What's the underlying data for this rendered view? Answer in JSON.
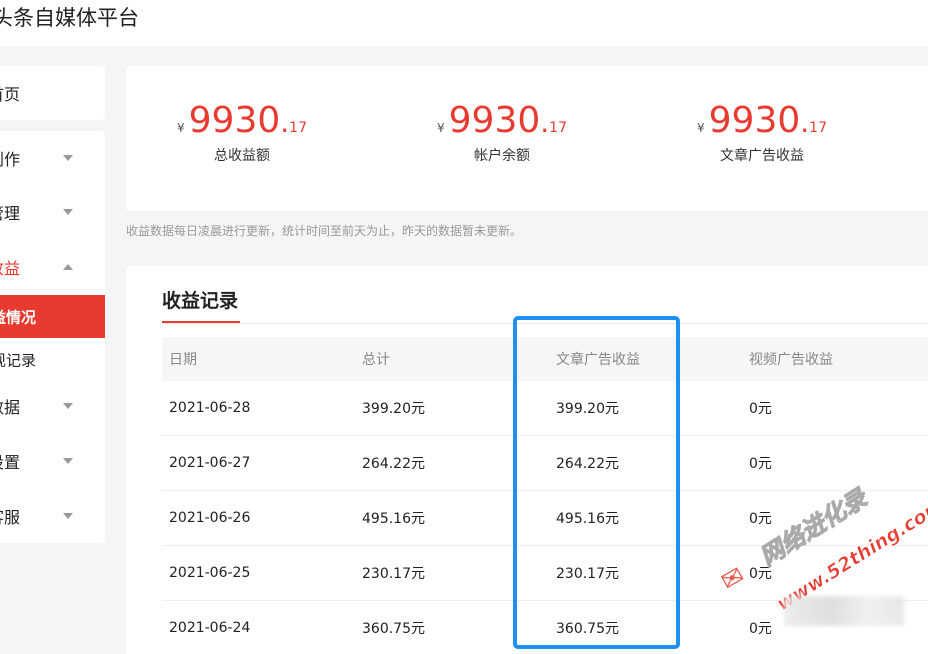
{
  "header": {
    "title": "头条自媒体平台"
  },
  "sidebar": {
    "home": "首页",
    "items": [
      {
        "label": "创作",
        "caret": "down"
      },
      {
        "label": "管理",
        "caret": "down"
      },
      {
        "label": "收益",
        "caret": "up",
        "open": true
      },
      {
        "label": "收益情况",
        "sub": true,
        "active": true
      },
      {
        "label": "提现记录",
        "sub": true
      },
      {
        "label": "数据",
        "caret": "down"
      },
      {
        "label": "设置",
        "caret": "down"
      },
      {
        "label": "客服",
        "caret": "down"
      }
    ]
  },
  "summary": {
    "currency_symbol": "¥",
    "stats": [
      {
        "int": "9930",
        "dec": "17",
        "label": "总收益额"
      },
      {
        "int": "9930",
        "dec": "17",
        "label": "帐户余额"
      },
      {
        "int": "9930",
        "dec": "17",
        "label": "文章广告收益"
      }
    ]
  },
  "note": "收益数据每日凌晨进行更新，统计时间至前天为止，昨天的数据暂未更新。",
  "records": {
    "title": "收益记录",
    "columns": [
      "日期",
      "总计",
      "文章广告收益",
      "视频广告收益"
    ],
    "rows": [
      [
        "2021-06-28",
        "399.20元",
        "399.20元",
        "0元"
      ],
      [
        "2021-06-27",
        "264.22元",
        "264.22元",
        "0元"
      ],
      [
        "2021-06-26",
        "495.16元",
        "495.16元",
        "0元"
      ],
      [
        "2021-06-25",
        "230.17元",
        "230.17元",
        "0元"
      ],
      [
        "2021-06-24",
        "360.75元",
        "360.75元",
        "0元"
      ]
    ]
  },
  "watermark": {
    "text_cn": "网络进化录",
    "url": "www.52thing.com"
  },
  "colors": {
    "accent": "#e83a2e",
    "highlight": "#1e90f0"
  }
}
